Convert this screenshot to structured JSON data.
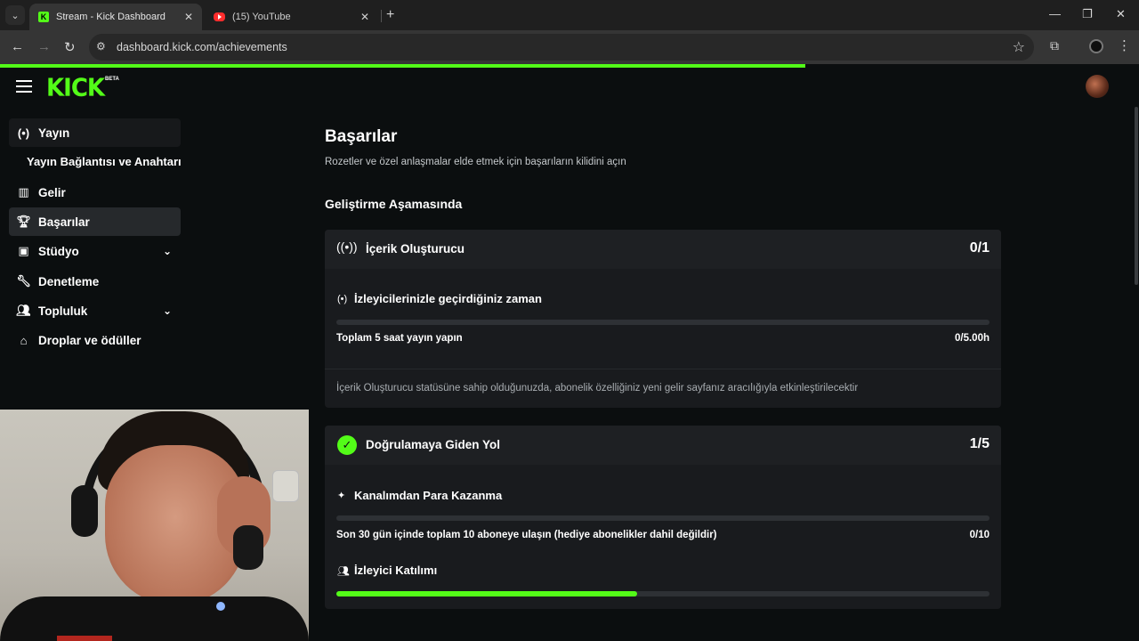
{
  "browser": {
    "tabs": [
      {
        "title": "Stream - Kick Dashboard",
        "active": true,
        "favicon": "kick-icon"
      },
      {
        "title": "(15) YouTube",
        "active": false,
        "favicon": "youtube-icon"
      }
    ],
    "url": "dashboard.kick.com/achievements",
    "load_progress": 0.707
  },
  "header": {
    "logo": "KICK",
    "beta": "BETA"
  },
  "sidebar": {
    "items": [
      {
        "label": "Yayın",
        "icon": "broadcast-icon"
      },
      {
        "label": "Gelir",
        "icon": "bar-chart-icon"
      },
      {
        "label": "Başarılar",
        "icon": "trophy-icon",
        "active": true
      },
      {
        "label": "Stüdyo",
        "icon": "film-icon",
        "expandable": true
      },
      {
        "label": "Denetleme",
        "icon": "wrench-icon"
      },
      {
        "label": "Topluluk",
        "icon": "users-icon",
        "expandable": true
      },
      {
        "label": "Droplar ve ödüller",
        "icon": "cake-icon"
      }
    ],
    "subitem": "Yayın Bağlantısı ve Anahtarı"
  },
  "main": {
    "title": "Başarılar",
    "subtitle": "Rozetler ve özel anlaşmalar elde etmek için başarıların kilidini açın",
    "section": "Geliştirme Aşamasında",
    "cards": [
      {
        "title": "İçerik Oluşturucu",
        "count": "0/1",
        "icon": "broadcast-icon",
        "items": [
          {
            "title": "İzleyicilerinizle geçirdiğiniz zaman",
            "icon": "broadcast-icon",
            "requirement": "Toplam 5 saat yayın yapın",
            "value": "0/5.00h",
            "progress": 0
          }
        ],
        "footer": "İçerik Oluşturucu statüsüne sahip olduğunuzda, abonelik özelliğiniz yeni gelir sayfanız aracılığıyla etkinleştirilecektir"
      },
      {
        "title": "Doğrulamaya Giden Yol",
        "count": "1/5",
        "icon": "verified-badge-icon",
        "items": [
          {
            "title": "Kanalımdan Para Kazanma",
            "icon": "sparkle-icon",
            "requirement": "Son 30 gün içinde toplam 10 aboneye ulaşın (hediye abonelikler dahil değildir)",
            "value": "0/10",
            "progress": 0
          },
          {
            "title": "İzleyici Katılımı",
            "icon": "users-icon",
            "progress": 0.46
          }
        ]
      }
    ]
  },
  "colors": {
    "accent": "#53fc18",
    "background": "#0b0e0f",
    "card": "#191b1e"
  }
}
